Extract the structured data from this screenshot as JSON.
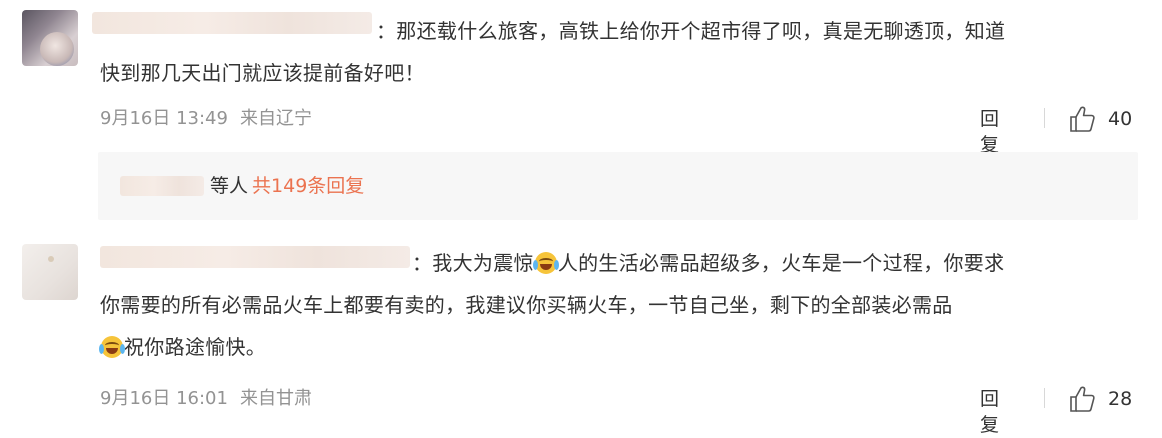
{
  "comments": [
    {
      "text_line1": "：那还载什么旅客，高铁上给你开个超市得了呗，真是无聊透顶，知道",
      "text_line2": "快到那几天出门就应该提前备好吧！",
      "date": "9月16日 13:49",
      "location": "来自辽宁",
      "reply_label": "回复",
      "likes": "40"
    },
    {
      "text_line1_a": "：我大为震惊",
      "text_line1_b": "人的生活必需品超级多，火车是一个过程，你要求",
      "text_line2": "你需要的所有必需品火车上都要有卖的，我建议你买辆火车，一节自己坐，剩下的全部装必需品",
      "text_line3": "祝你路途愉快。",
      "date": "9月16日 16:01",
      "location": "来自甘肃",
      "reply_label": "回复",
      "likes": "28"
    }
  ],
  "thread": {
    "suffix": "等人",
    "reply_link": "共149条回复"
  },
  "icons": {
    "like": "thumbs-up-icon",
    "emoji": "laughing-crying-emoji-icon"
  },
  "colors": {
    "link": "#eb7350",
    "meta": "#939393",
    "text": "#333333",
    "thread_bg": "#f7f7f7"
  }
}
